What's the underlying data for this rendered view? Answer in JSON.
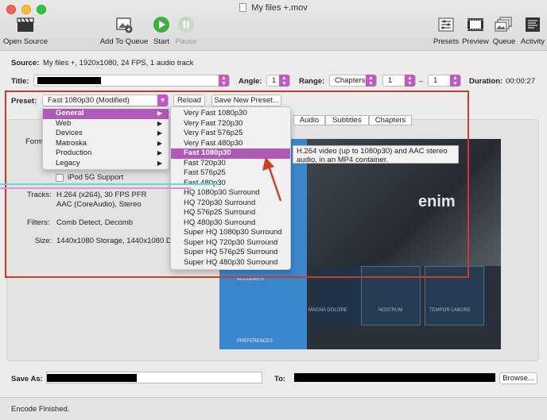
{
  "window": {
    "title": "My files +.mov"
  },
  "toolbar": {
    "open_source": "Open Source",
    "add_to_queue": "Add To Queue",
    "start": "Start",
    "pause": "Pause",
    "presets": "Presets",
    "preview": "Preview",
    "queue": "Queue",
    "activity": "Activity"
  },
  "source": {
    "label": "Source:",
    "value": "My files +, 1920x1080, 24 FPS, 1 audio track"
  },
  "title_row": {
    "label": "Title:",
    "angle_label": "Angle:",
    "angle_value": "1",
    "range_label": "Range:",
    "range_mode": "Chapters",
    "range_start": "1",
    "range_dash": "–",
    "range_end": "1",
    "duration_label": "Duration:",
    "duration_value": "00:00:27"
  },
  "preset_row": {
    "label": "Preset:",
    "selected": "Fast 1080p30 (Modified)",
    "reload": "Reload",
    "save_new": "Save New Preset..."
  },
  "tabs": {
    "audio": "Audio",
    "subtitles": "Subtitles",
    "chapters": "Chapters"
  },
  "summary": {
    "format_label": "Form",
    "ipod": "iPod 5G Support",
    "tracks_label": "Tracks:",
    "tracks_line1": "H.264 (x264), 30 FPS PFR",
    "tracks_line2": "AAC (CoreAudio), Stereo",
    "filters_label": "Filters:",
    "filters_value": "Comb Detect, Decomb",
    "size_label": "Size:",
    "size_value": "1440x1080 Storage, 1440x1080 Dis"
  },
  "category_menu": [
    {
      "label": "General",
      "selected": true
    },
    {
      "label": "Web",
      "selected": false
    },
    {
      "label": "Devices",
      "selected": false
    },
    {
      "label": "Matroska",
      "selected": false
    },
    {
      "label": "Production",
      "selected": false
    },
    {
      "label": "Legacy",
      "selected": false
    }
  ],
  "preset_menu": [
    {
      "label": "Very Fast 1080p30"
    },
    {
      "label": "Very Fast 720p30"
    },
    {
      "label": "Very Fast 576p25"
    },
    {
      "label": "Very Fast 480p30"
    },
    {
      "label": "Fast 1080p30",
      "selected": true
    },
    {
      "label": "Fast 720p30"
    },
    {
      "label": "Fast 576p25"
    },
    {
      "label": "Fast 480p30"
    },
    {
      "label": "HQ 1080p30 Surround"
    },
    {
      "label": "HQ 720p30 Surround"
    },
    {
      "label": "HQ 576p25 Surround"
    },
    {
      "label": "HQ 480p30 Surround"
    },
    {
      "label": "Super HQ 1080p30 Surround"
    },
    {
      "label": "Super HQ 720p30 Surround"
    },
    {
      "label": "Super HQ 576p25 Surround"
    },
    {
      "label": "Super HQ 480p30 Surround"
    }
  ],
  "tooltip": {
    "line1": "H.264 video (up to 1080p30) and AAC stereo",
    "line2": "audio, in an MP4 container."
  },
  "preview_frame": {
    "brand": "enim",
    "menu_accounts": "ACCOUNTS",
    "menu_preferences": "PREFERENCES",
    "tile1": "MAGNA DOLORE",
    "tile2": "NOSTRUM",
    "tile3": "TEMPOR LABORE"
  },
  "save_row": {
    "save_as_label": "Save As:",
    "to_label": "To:",
    "browse": "Browse..."
  },
  "status": {
    "text": "Encode Finished."
  },
  "colors": {
    "accent": "#c258c7",
    "highlight_outline": "#cc3b26",
    "menu_selection": "#b05ab8",
    "annotation_arrow": "#d23a22"
  }
}
